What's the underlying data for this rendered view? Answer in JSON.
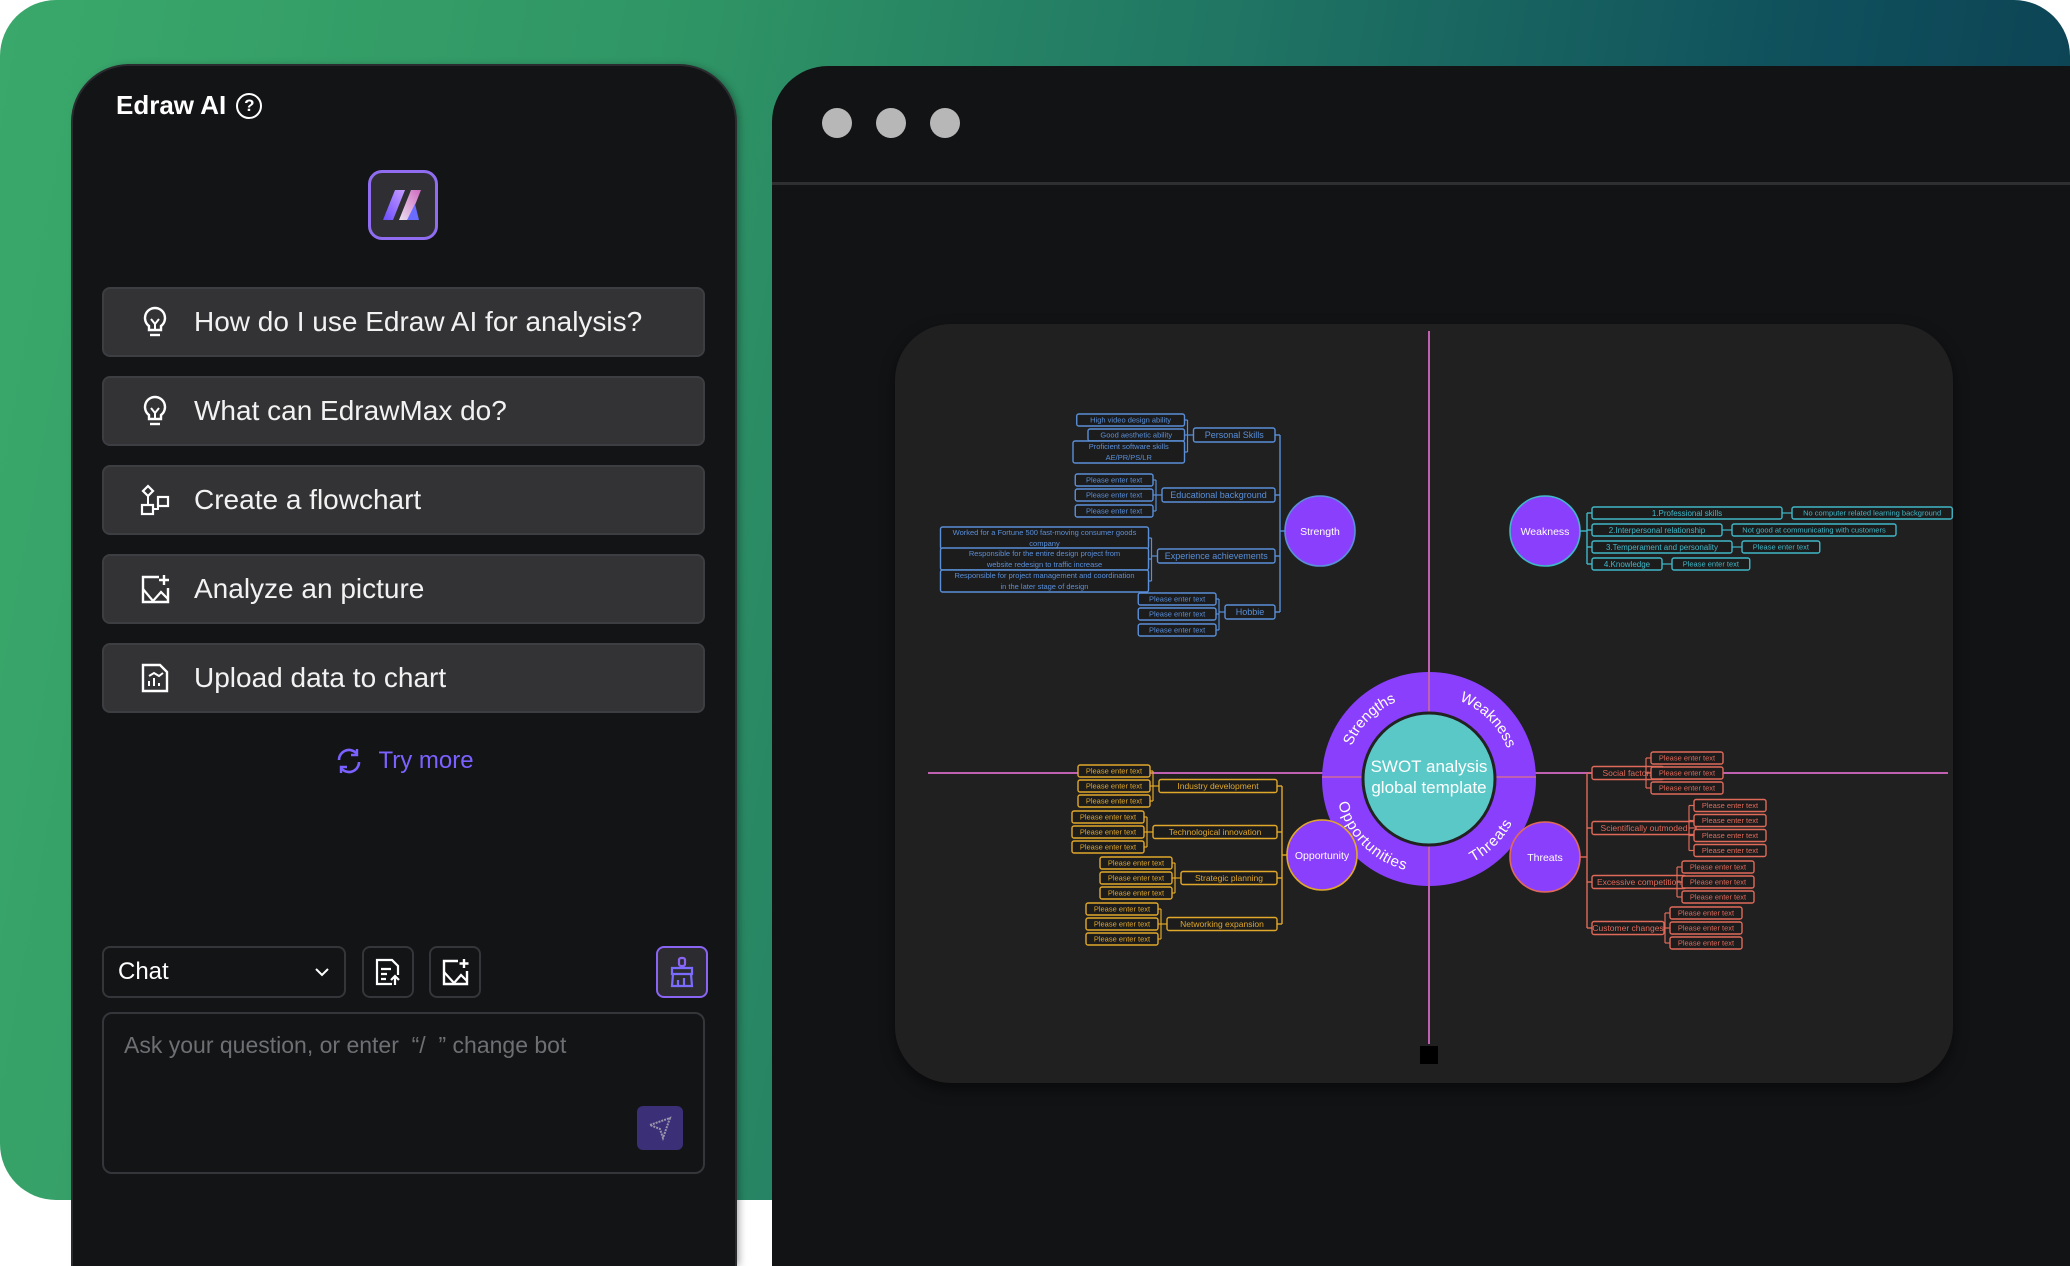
{
  "panel": {
    "title": "Edraw AI",
    "help_icon": "question-circle-icon",
    "logo_icon": "edraw-ai-logo",
    "suggestions": [
      {
        "icon": "lightbulb-icon",
        "label": "How do I use Edraw AI for analysis?"
      },
      {
        "icon": "lightbulb-icon",
        "label": "What can EdrawMax do?"
      },
      {
        "icon": "flowchart-icon",
        "label": "Create a flowchart"
      },
      {
        "icon": "image-add-icon",
        "label": "Analyze an picture"
      },
      {
        "icon": "chart-file-icon",
        "label": "Upload data to chart"
      }
    ],
    "try_more": "Try more",
    "mode_select": {
      "value": "Chat"
    },
    "toolbar_icons": [
      "file-upload-icon",
      "image-add-icon",
      "brush-clean-icon"
    ],
    "input": {
      "value": "",
      "placeholder": "Ask your question, or enter  “/  ” change bot"
    },
    "send_icon": "send-icon"
  },
  "window": {
    "controls": [
      "close",
      "minimize",
      "maximize"
    ]
  },
  "diagram": {
    "center": {
      "line1": "SWOT analysis",
      "line2": "global template"
    },
    "ring": {
      "strengths": "Strengths",
      "weakness": "Weakness",
      "opportunities": "Opportunities",
      "threats": "Threats"
    },
    "colors": {
      "node": "#8a3ffc",
      "center": "#5bc8c8",
      "strength": "#5a8fd8",
      "weakness": "#3fb8c8",
      "opportunity": "#e0a82a",
      "threats": "#e06a5a",
      "axis": "#c060b0"
    },
    "strength": {
      "label": "Strength",
      "branches": [
        {
          "label": "Personal Skills",
          "leaves": [
            "High video design ability",
            "Good aesthetic ability",
            "Proficient software skills AE/PR/PS/LR"
          ]
        },
        {
          "label": "Educational background",
          "leaves": [
            "Please enter text",
            "Please enter text",
            "Please enter text"
          ]
        },
        {
          "label": "Experience achievements",
          "leaves": [
            "Worked for a Fortune 500 fast-moving consumer goods company",
            "Responsible for the entire design project from website redesign to traffic increase",
            "Responsible for project management and coordination in the later stage of design"
          ]
        },
        {
          "label": "Hobbie",
          "leaves": [
            "Please enter text",
            "Please enter text",
            "Please enter text"
          ]
        }
      ]
    },
    "weakness": {
      "label": "Weakness",
      "branches": [
        {
          "label": "1.Professional skills",
          "leaves": [
            "No computer related learning background"
          ]
        },
        {
          "label": "2.Interpersonal relationship",
          "leaves": [
            "Not good at communicating with customers"
          ]
        },
        {
          "label": "3.Temperament and personality",
          "leaves": [
            "Please enter text"
          ]
        },
        {
          "label": "4.Knowledge",
          "leaves": [
            "Please enter text"
          ]
        }
      ]
    },
    "opportunity": {
      "label": "Opportunity",
      "branches": [
        {
          "label": "Industry development",
          "leaves": [
            "Please enter text",
            "Please enter text",
            "Please enter text"
          ]
        },
        {
          "label": "Technological innovation",
          "leaves": [
            "Please enter text",
            "Please enter text",
            "Please enter text"
          ]
        },
        {
          "label": "Strategic planning",
          "leaves": [
            "Please enter text",
            "Please enter text",
            "Please enter text"
          ]
        },
        {
          "label": "Networking expansion",
          "leaves": [
            "Please enter text",
            "Please enter text",
            "Please enter text"
          ]
        }
      ]
    },
    "threats": {
      "label": "Threats",
      "branches": [
        {
          "label": "Social factors",
          "leaves": [
            "Please enter text",
            "Please enter text",
            "Please enter text"
          ]
        },
        {
          "label": "Scientifically outmoded",
          "leaves": [
            "Please enter text",
            "Please enter text",
            "Please enter text",
            "Please enter text"
          ]
        },
        {
          "label": "Excessive competition",
          "leaves": [
            "Please enter text",
            "Please enter text",
            "Please enter text"
          ]
        },
        {
          "label": "Customer changes",
          "leaves": [
            "Please enter text",
            "Please enter text",
            "Please enter text"
          ]
        }
      ]
    }
  }
}
